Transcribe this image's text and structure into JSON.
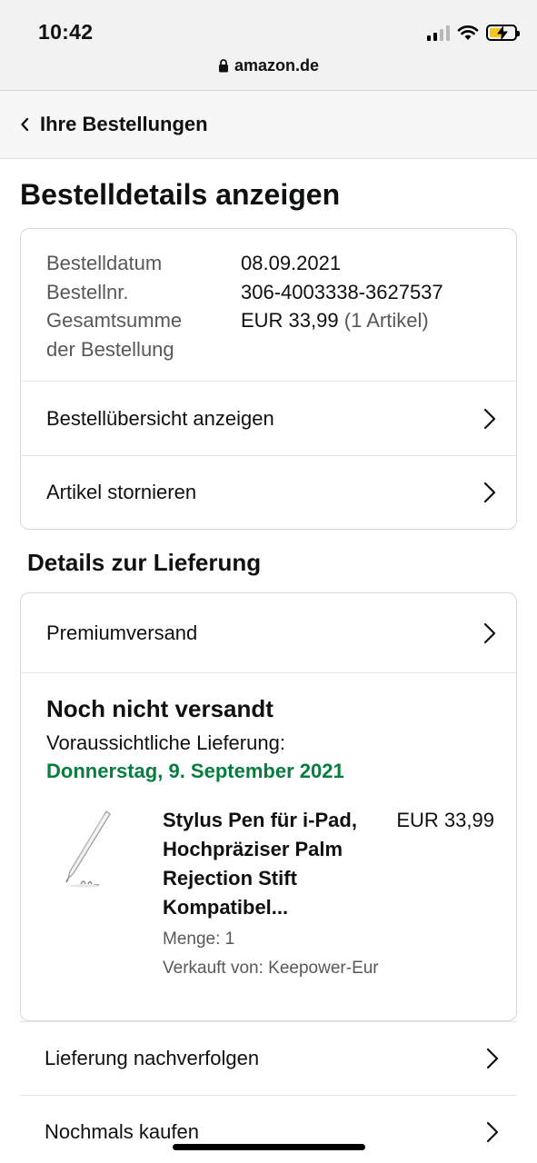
{
  "status_bar": {
    "time": "10:42"
  },
  "browser": {
    "url": "amazon.de"
  },
  "nav": {
    "back_label": "Ihre Bestellungen"
  },
  "page": {
    "title": "Bestelldetails anzeigen"
  },
  "order": {
    "date_label": "Bestelldatum",
    "date_value": "08.09.2021",
    "number_label": "Bestellnr.",
    "number_value": "306-4003338-3627537",
    "total_label_line1": "Gesamtsumme",
    "total_label_line2": "der Bestellung",
    "total_value": "EUR 33,99",
    "total_count": "(1 Artikel)",
    "links": [
      {
        "label": "Bestellübersicht anzeigen"
      },
      {
        "label": "Artikel stornieren"
      }
    ]
  },
  "delivery": {
    "section_title": "Details zur Lieferung",
    "shipping_method": "Premiumversand",
    "status": "Noch nicht versandt",
    "eta_label": "Voraussichtliche Lieferung:",
    "eta_date": "Donnerstag, 9. September 2021",
    "item": {
      "title": "Stylus Pen für i-Pad, Hochpräziser Palm Rejection Stift Kompatibel...",
      "price": "EUR 33,99",
      "quantity": "Menge: 1",
      "seller": "Verkauft von: Keepower-Eur"
    }
  },
  "actions": [
    {
      "label": "Lieferung nachverfolgen"
    },
    {
      "label": "Nochmals kaufen"
    }
  ],
  "colors": {
    "delivery_green": "#067d3e",
    "battery_yellow": "#f5c518"
  }
}
